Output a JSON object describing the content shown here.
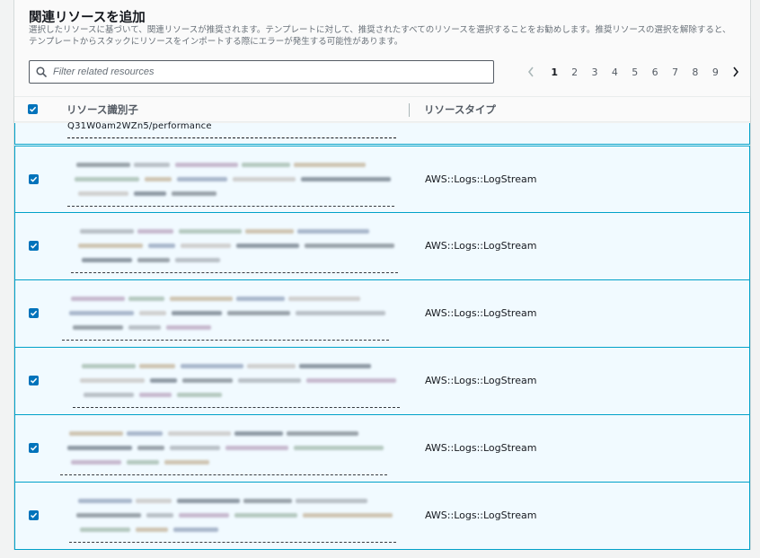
{
  "section": {
    "title": "関連リソースを追加",
    "description": "選択したリソースに基づいて、関連リソースが推奨されます。テンプレートに対して、推奨されたすべてのリソースを選択することをお勧めします。推奨リソースの選択を解除すると、テンプレートからスタックにリソースをインポートする際にエラーが発生する可能性があります。"
  },
  "search": {
    "placeholder": "Filter related resources",
    "icon": "search-icon"
  },
  "pagination": {
    "pages": [
      "1",
      "2",
      "3",
      "4",
      "5",
      "6",
      "7",
      "8",
      "9"
    ],
    "current": "1",
    "prev_icon": "chevron-left-icon",
    "next_icon": "chevron-right-icon"
  },
  "table": {
    "columns": {
      "identifier": "リソース識別子",
      "type": "リソースタイプ"
    },
    "partial_row_identifier_tail": "Q31W0am2WZn5/performance",
    "rows": [
      {
        "selected": true,
        "type": "AWS::Logs::LogStream"
      },
      {
        "selected": true,
        "type": "AWS::Logs::LogStream"
      },
      {
        "selected": true,
        "type": "AWS::Logs::LogStream"
      },
      {
        "selected": true,
        "type": "AWS::Logs::LogStream"
      },
      {
        "selected": true,
        "type": "AWS::Logs::LogStream"
      },
      {
        "selected": true,
        "type": "AWS::Logs::LogStream"
      }
    ]
  },
  "colors": {
    "accent": "#0073bb",
    "selected_row_bg": "#f1faff",
    "selected_row_border": "#00a1c9"
  }
}
